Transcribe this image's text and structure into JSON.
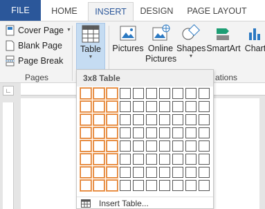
{
  "tabs": [
    {
      "label": "FILE"
    },
    {
      "label": "HOME"
    },
    {
      "label": "INSERT"
    },
    {
      "label": "DESIGN"
    },
    {
      "label": "PAGE LAYOUT"
    }
  ],
  "ribbon": {
    "pages": {
      "items": [
        "Cover Page",
        "Blank Page",
        "Page Break"
      ],
      "group_label": "Pages"
    },
    "table_label": "Table",
    "pictures_label": "Pictures",
    "online_pictures_line1": "Online",
    "online_pictures_line2": "Pictures",
    "shapes_label": "Shapes",
    "smartart_label": "SmartArt",
    "chart_label": "Chart",
    "illustrations_label": "ations"
  },
  "table_dropdown": {
    "header": "3x8 Table",
    "rows": 8,
    "cols": 10,
    "selected_cols": 3,
    "selected_rows": 8,
    "insert_table_label": "Insert Table..."
  },
  "colors": {
    "file_tab": "#2b579a",
    "active_tab_text": "#2b579a",
    "selection": "#e07a27",
    "table_button_bg": "#c5dcf2"
  }
}
